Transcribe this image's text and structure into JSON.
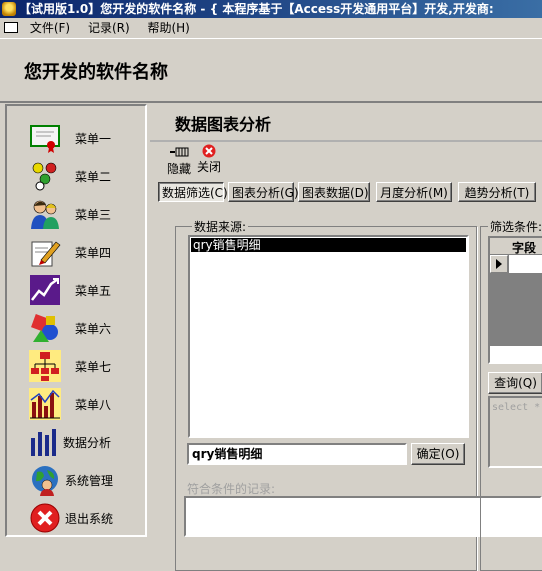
{
  "window": {
    "title": "【试用版1.0】您开发的软件名称 - { 本程序基于【Access开发通用平台】开发,开发商:"
  },
  "menubar": {
    "items": [
      "文件(F)",
      "记录(R)",
      "帮助(H)"
    ]
  },
  "app": {
    "title": "您开发的软件名称"
  },
  "sidebar": {
    "items": [
      {
        "label": "菜单一",
        "icon": "certificate-icon"
      },
      {
        "label": "菜单二",
        "icon": "molecule-icon"
      },
      {
        "label": "菜单三",
        "icon": "users-icon"
      },
      {
        "label": "菜单四",
        "icon": "edit-pencil-icon"
      },
      {
        "label": "菜单五",
        "icon": "trend-chart-icon"
      },
      {
        "label": "菜单六",
        "icon": "shapes-icon"
      },
      {
        "label": "菜单七",
        "icon": "org-chart-icon"
      },
      {
        "label": "菜单八",
        "icon": "bar-chart-icon"
      },
      {
        "label": "数据分析",
        "icon": "analytics-bars-icon"
      },
      {
        "label": "系统管理",
        "icon": "globe-user-icon"
      },
      {
        "label": "退出系统",
        "icon": "exit-x-icon"
      }
    ]
  },
  "page": {
    "title": "数据图表分析"
  },
  "toolbar": {
    "hide_label": "隐藏",
    "close_label": "关闭"
  },
  "tabs": [
    "数据筛选(C)",
    "图表分析(G)",
    "图表数据(D)",
    "月度分析(M)",
    "趋势分析(T)"
  ],
  "active_tab": "数据筛选(C)",
  "source": {
    "label": "数据来源:",
    "items": [
      "qry销售明细"
    ],
    "selected": "qry销售明细",
    "input_value": "qry销售明细",
    "confirm_label": "确定(O)"
  },
  "filter": {
    "label": "筛选条件:",
    "column_header": "字段",
    "query_button": "查询(Q)",
    "sql_placeholder": "select *"
  },
  "results": {
    "label": "符合条件的记录:"
  }
}
